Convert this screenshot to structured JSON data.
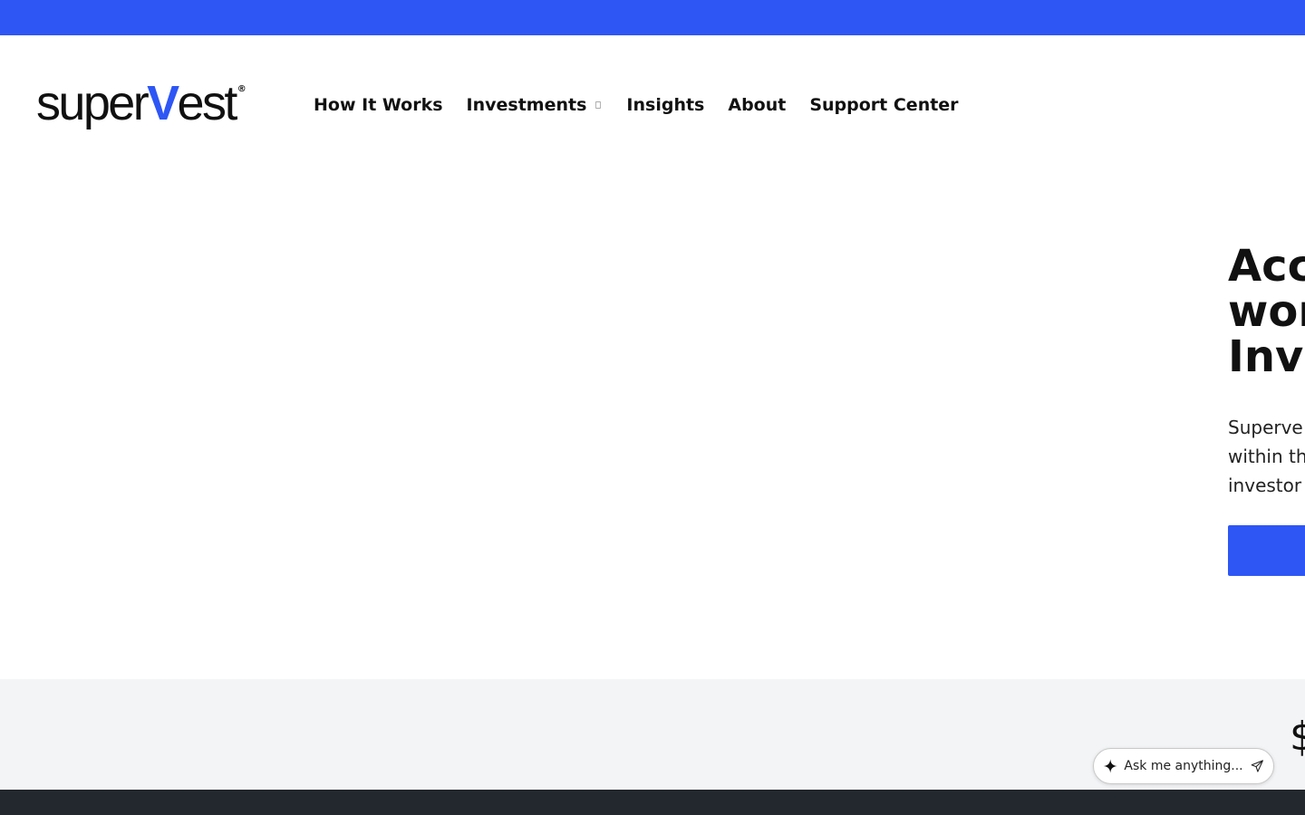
{
  "brand": {
    "logo_prefix": "super",
    "logo_v": "V",
    "logo_suffix": "est",
    "logo_registered": "®",
    "accent_color": "#2e56f5"
  },
  "nav": {
    "items": [
      {
        "label": "How It Works"
      },
      {
        "label": "Investments",
        "has_dropdown": true,
        "dropdown_icon": "chevron-down-icon"
      },
      {
        "label": "Insights"
      },
      {
        "label": "About"
      },
      {
        "label": "Support Center"
      }
    ]
  },
  "hero": {
    "title": "Acc\nwor\nInve",
    "body": "Superve\nwithin th\ninvestor"
  },
  "stats": {
    "value": "$"
  },
  "assistant": {
    "placeholder": "Ask me anything...",
    "icon": "sparkle-icon",
    "send_icon": "send-icon"
  },
  "colors": {
    "top_bar": "#2e56f5",
    "stats_bg": "#f3f4f6",
    "footer": "#23272e"
  }
}
